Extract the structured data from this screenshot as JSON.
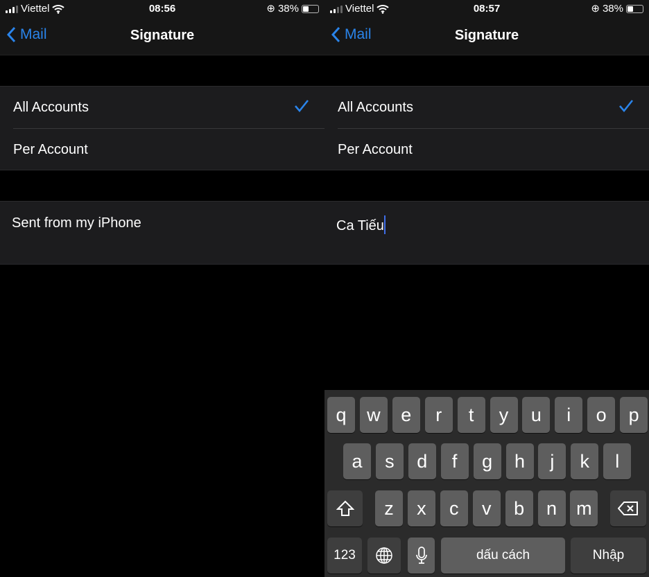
{
  "screens": [
    {
      "status": {
        "carrier": "Viettel",
        "time": "08:56",
        "battery": "38%"
      },
      "nav": {
        "back": "Mail",
        "title": "Signature"
      },
      "options": [
        "All Accounts",
        "Per Account"
      ],
      "selected": "All Accounts",
      "signature": "Sent from my iPhone"
    },
    {
      "status": {
        "carrier": "Viettel",
        "time": "08:57",
        "battery": "38%"
      },
      "nav": {
        "back": "Mail",
        "title": "Signature"
      },
      "options": [
        "All Accounts",
        "Per Account"
      ],
      "selected": "All Accounts",
      "signature": "Ca Tiếu"
    }
  ],
  "keyboard": {
    "row1": [
      "q",
      "w",
      "e",
      "r",
      "t",
      "y",
      "u",
      "i",
      "o",
      "p"
    ],
    "row2": [
      "a",
      "s",
      "d",
      "f",
      "g",
      "h",
      "j",
      "k",
      "l"
    ],
    "row3": [
      "z",
      "x",
      "c",
      "v",
      "b",
      "n",
      "m"
    ],
    "numbers": "123",
    "space": "dấu cách",
    "return": "Nhập",
    "icons": [
      "shift-icon",
      "delete-icon",
      "globe-icon",
      "microphone-icon"
    ]
  },
  "colors": {
    "accent": "#2a84ea",
    "caret": "#3f6ee8"
  }
}
